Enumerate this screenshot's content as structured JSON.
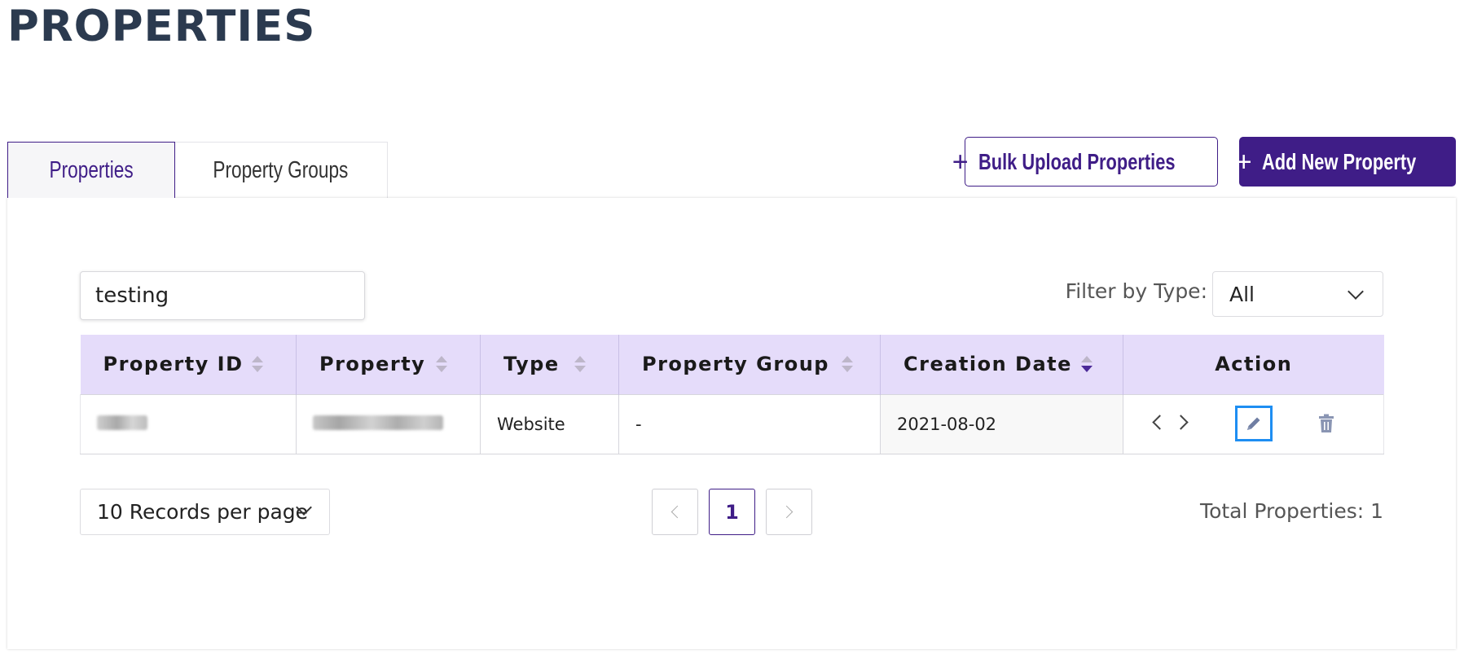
{
  "page": {
    "title": "PROPERTIES"
  },
  "tabs": [
    {
      "label": "Properties",
      "active": true
    },
    {
      "label": "Property Groups",
      "active": false
    }
  ],
  "toolbar": {
    "bulk_upload_label": "Bulk Upload Properties",
    "add_new_label": "Add New Property",
    "plus_glyph": "+"
  },
  "search": {
    "value": "testing"
  },
  "filter": {
    "label": "Filter by Type:",
    "selected": "All"
  },
  "table": {
    "columns": [
      "Property ID",
      "Property",
      "Type",
      "Property Group",
      "Creation Date",
      "Action"
    ],
    "sorted_column": "Creation Date",
    "rows": [
      {
        "property_id": "",
        "property": "",
        "type": "Website",
        "property_group": "-",
        "creation_date": "2021-08-02"
      }
    ]
  },
  "pagination": {
    "per_page_label": "10 Records per page",
    "current_page": "1"
  },
  "summary": {
    "total_label": "Total Properties: 1"
  },
  "colors": {
    "brand": "#3f1d87",
    "header_bg": "#e5dcfa",
    "focus": "#1e8ef2"
  }
}
